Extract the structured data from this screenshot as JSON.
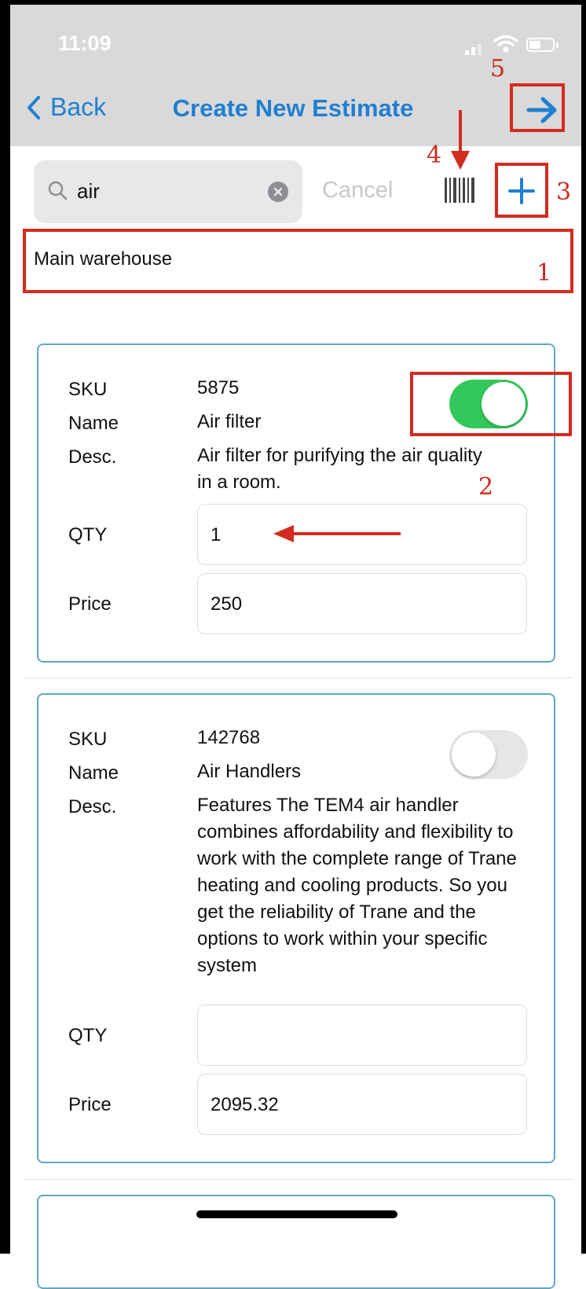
{
  "status_bar": {
    "time": "11:09"
  },
  "nav": {
    "back_label": "Back",
    "title": "Create New Estimate",
    "next_icon": "arrow-right-icon"
  },
  "search": {
    "value": "air",
    "cancel_label": "Cancel"
  },
  "warehouse": {
    "label": "Main warehouse"
  },
  "items": [
    {
      "sku_label": "SKU",
      "sku": "5875",
      "name_label": "Name",
      "name": "Air filter",
      "desc_label": "Desc.",
      "desc": "Air filter for purifying the air quality in a room.",
      "qty_label": "QTY",
      "qty": "1",
      "price_label": "Price",
      "price": "250",
      "selected": true
    },
    {
      "sku_label": "SKU",
      "sku": "142768",
      "name_label": "Name",
      "name": "Air Handlers",
      "desc_label": "Desc.",
      "desc": "Features The TEM4 air handler combines affordability and flexibility to work with the complete range of Trane heating and cooling products. So you get the reliability of Trane and the options to work within your specific system",
      "qty_label": "QTY",
      "qty": "",
      "price_label": "Price",
      "price": "2095.32",
      "selected": false
    }
  ],
  "annotations": {
    "color": "#d22c1f",
    "labels": [
      "1",
      "2",
      "3",
      "4",
      "5"
    ]
  },
  "colors": {
    "accent": "#1f7fd1",
    "toggle_on": "#34c759",
    "card_border": "#61a8c4"
  }
}
